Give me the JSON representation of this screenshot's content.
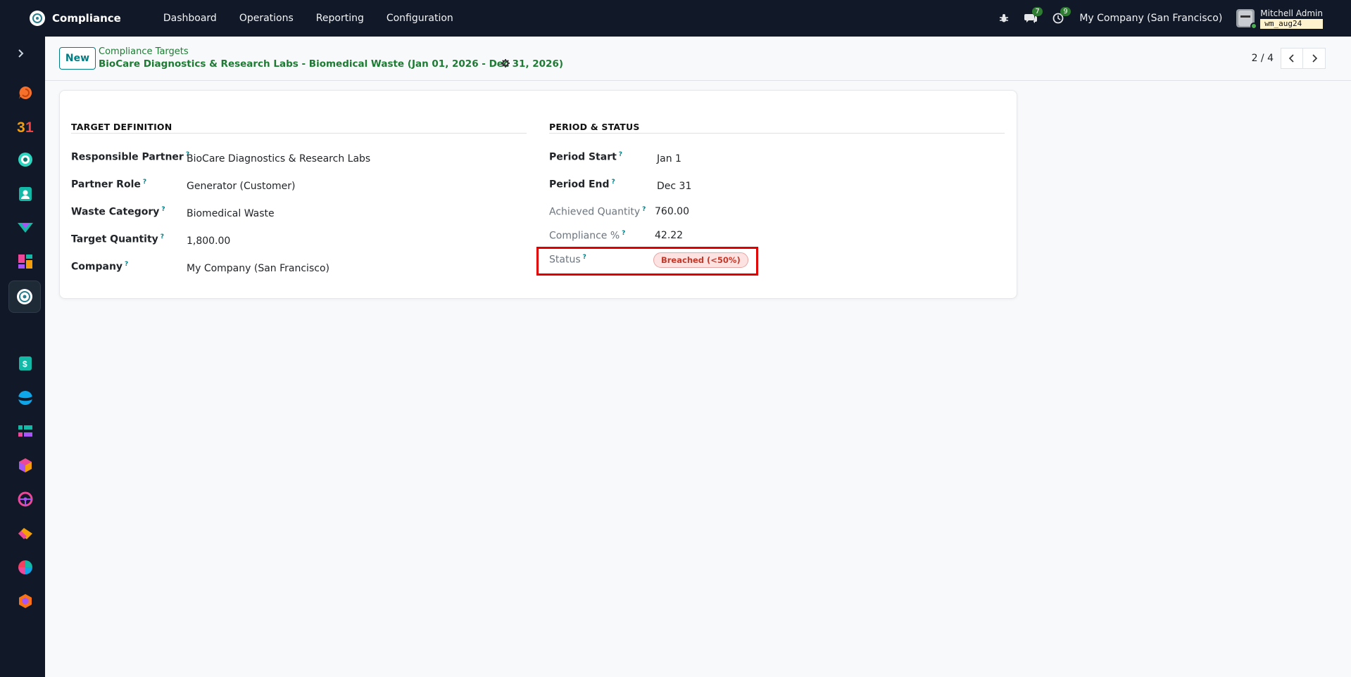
{
  "topbar": {
    "app_name": "Compliance",
    "menu": [
      "Dashboard",
      "Operations",
      "Reporting",
      "Configuration"
    ],
    "messages_count": "7",
    "activities_count": "9",
    "company": "My Company (San Francisco)",
    "user_name": "Mitchell Admin",
    "database": "wm_aug24"
  },
  "control_panel": {
    "new_label": "New",
    "breadcrumb_parent": "Compliance Targets",
    "breadcrumb_current": "BioCare Diagnostics & Research Labs - Biomedical Waste (Jan 01, 2026 - Dec 31, 2026)",
    "pager": "2 / 4"
  },
  "form": {
    "left_section": {
      "title": "TARGET DEFINITION",
      "fields": [
        {
          "label": "Responsible Partner",
          "value": "BioCare Diagnostics & Research Labs"
        },
        {
          "label": "Partner Role",
          "value": "Generator (Customer)"
        },
        {
          "label": "Waste Category",
          "value": "Biomedical Waste"
        },
        {
          "label": "Target Quantity",
          "value": "1,800.00"
        },
        {
          "label": "Company",
          "value": "My Company (San Francisco)"
        }
      ]
    },
    "right_section": {
      "title": "PERIOD & STATUS",
      "fields": [
        {
          "label": "Period Start",
          "value": "Jan 1"
        },
        {
          "label": "Period End",
          "value": "Dec 31"
        },
        {
          "label": "Achieved Quantity",
          "value": "760.00"
        },
        {
          "label": "Compliance %",
          "value": "42.22"
        },
        {
          "label": "Status",
          "value": "Breached (<50%)"
        }
      ]
    },
    "help_marker": "?"
  },
  "sidebar_apps": [
    "discuss-icon",
    "calendar-icon",
    "compliance-icon",
    "contacts-icon",
    "crm-icon",
    "dashboards-icon",
    "compliance-active-icon",
    "invoicing-icon",
    "website-icon",
    "project-icon",
    "inventory-icon",
    "fleet-icon",
    "sales-icon",
    "spreadsheet-icon",
    "odoo-icon"
  ],
  "colors": {
    "navbar": "#111827",
    "accent": "#017e84",
    "breadcrumb": "#1e7b34",
    "danger_badge": "#c0392b",
    "highlight": "#e00000"
  }
}
